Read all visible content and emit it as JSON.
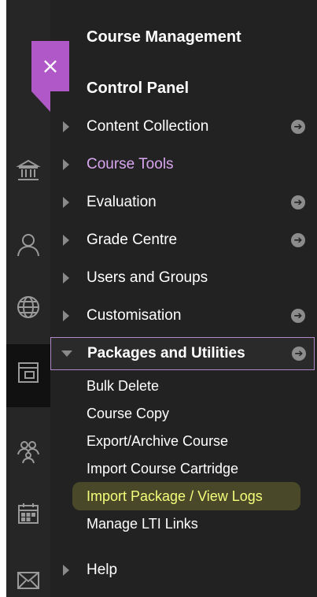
{
  "panel": {
    "course_management": "Course Management",
    "control_panel": "Control Panel"
  },
  "close": {
    "icon": "×"
  },
  "menu": [
    {
      "label": "Content Collection",
      "has_go": true
    },
    {
      "label": "Course Tools",
      "has_go": false
    },
    {
      "label": "Evaluation",
      "has_go": true
    },
    {
      "label": "Grade Centre",
      "has_go": true
    },
    {
      "label": "Users and Groups",
      "has_go": false
    },
    {
      "label": "Customisation",
      "has_go": true
    },
    {
      "label": "Packages and Utilities",
      "has_go": true,
      "expanded": true
    }
  ],
  "submenu": [
    "Bulk Delete",
    "Course Copy",
    "Export/Archive Course",
    "Import Course Cartridge",
    "Import Package / View Logs",
    "Manage LTI Links"
  ],
  "help": {
    "label": "Help"
  },
  "go_icon": "➔",
  "colors": {
    "accent": "#b058c8",
    "panel_bg": "#222222",
    "rail_bg": "#262626",
    "course_tools": "#d9a6f0",
    "highlight": "#f2ff7a"
  },
  "rail_icons": [
    "institution-icon",
    "user-icon",
    "globe-icon",
    "course-icon",
    "groups-icon",
    "calendar-icon",
    "mail-icon"
  ]
}
